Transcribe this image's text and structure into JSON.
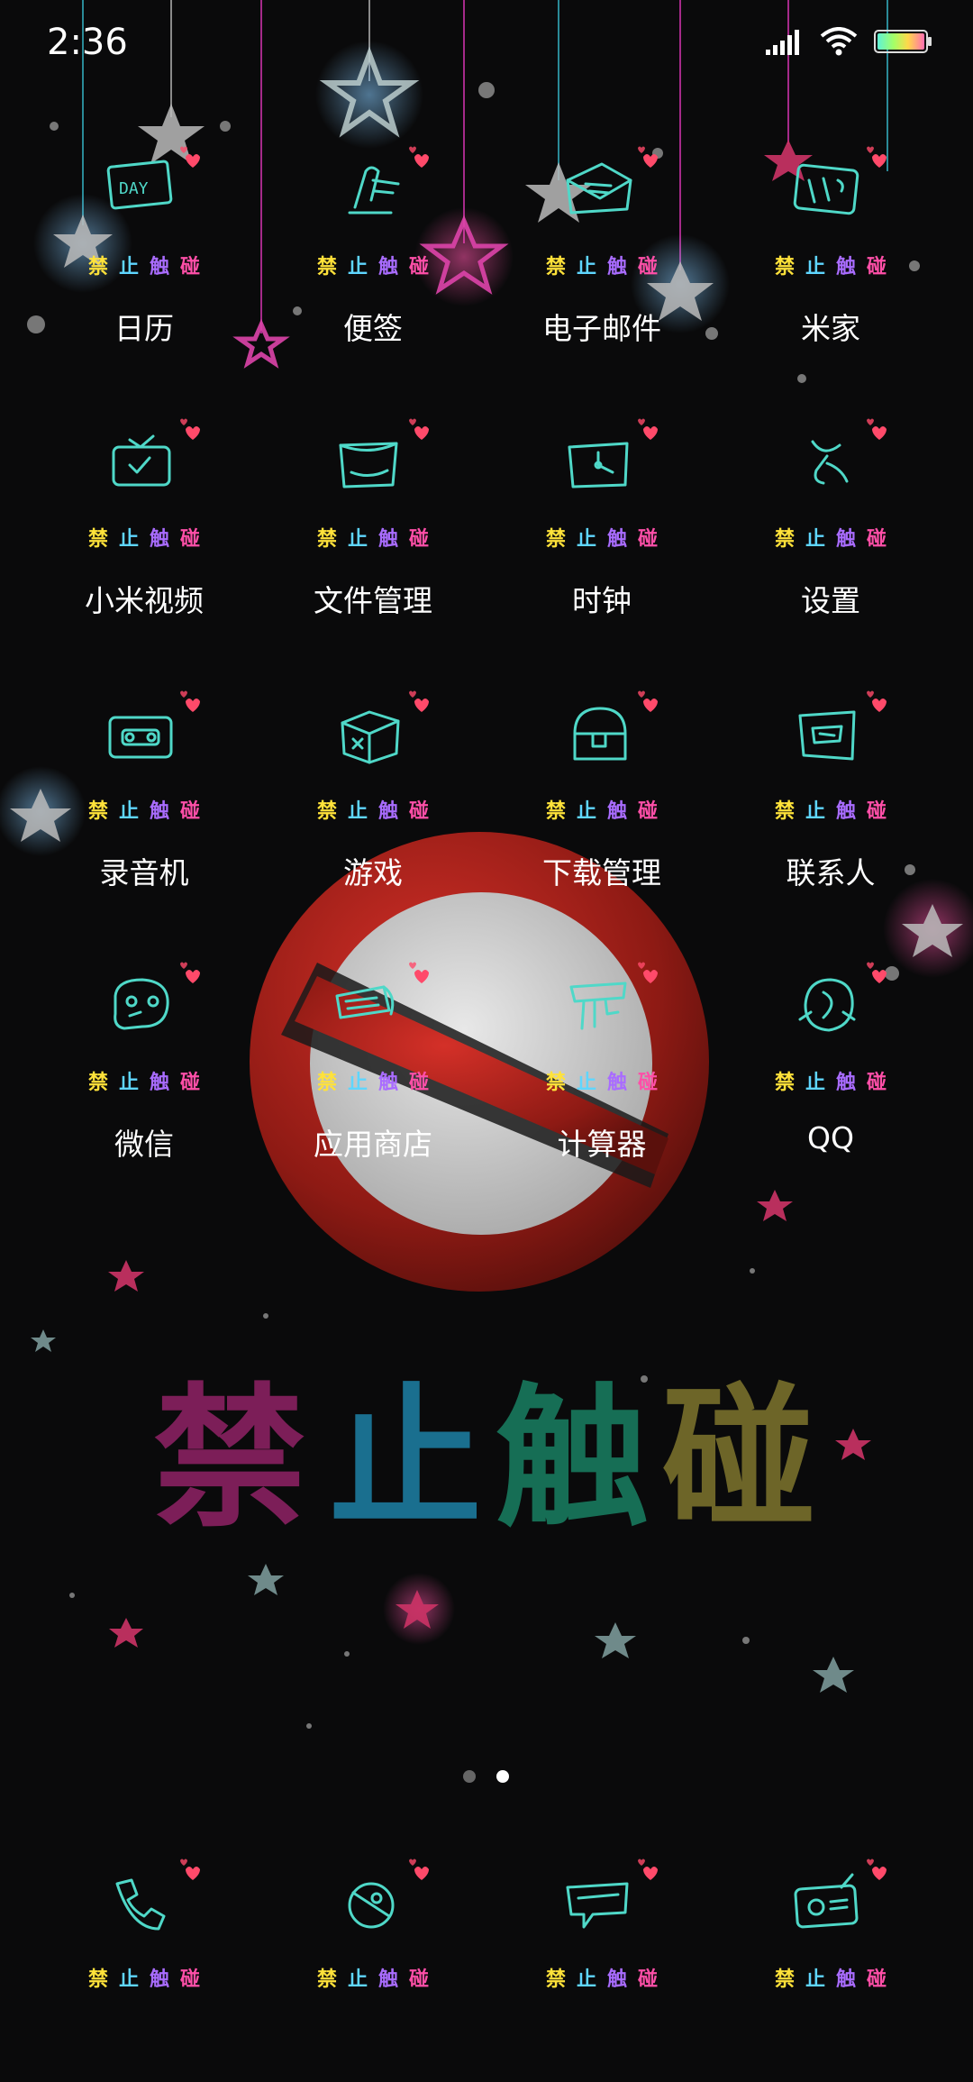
{
  "status_bar": {
    "time": "2:36"
  },
  "colors": {
    "tag_1": "#ffe23a",
    "tag_2": "#5fd6ff",
    "tag_3": "#a96cff",
    "tag_4": "#ff4fa8",
    "icon_stroke": "#4fd8c8",
    "heart": "#ff4a6a"
  },
  "apps": [
    {
      "label": "日历",
      "icon": "calendar-day-icon"
    },
    {
      "label": "便签",
      "icon": "notes-pen-icon"
    },
    {
      "label": "电子邮件",
      "icon": "envelope-icon"
    },
    {
      "label": "米家",
      "icon": "mijia-tools-icon"
    },
    {
      "label": "小米视频",
      "icon": "tv-icon"
    },
    {
      "label": "文件管理",
      "icon": "folder-box-icon"
    },
    {
      "label": "时钟",
      "icon": "clock-icon"
    },
    {
      "label": "设置",
      "icon": "wrench-icon"
    },
    {
      "label": "录音机",
      "icon": "cassette-icon"
    },
    {
      "label": "游戏",
      "icon": "game-cube-icon"
    },
    {
      "label": "下载管理",
      "icon": "treasure-chest-icon"
    },
    {
      "label": "联系人",
      "icon": "contact-card-icon"
    },
    {
      "label": "微信",
      "icon": "chat-bubble-icon"
    },
    {
      "label": "应用商店",
      "icon": "store-icon"
    },
    {
      "label": "计算器",
      "icon": "calculator-icon"
    },
    {
      "label": "QQ",
      "icon": "penguin-icon"
    }
  ],
  "dock": [
    {
      "icon": "phone-icon"
    },
    {
      "icon": "camera-icon"
    },
    {
      "icon": "message-icon"
    },
    {
      "icon": "radio-icon"
    }
  ],
  "tag_text": [
    "禁",
    "止",
    "触",
    "碰"
  ],
  "wallpaper_text": [
    "禁",
    "止",
    "触",
    "碰"
  ],
  "pager": {
    "count": 2,
    "current": 2
  }
}
